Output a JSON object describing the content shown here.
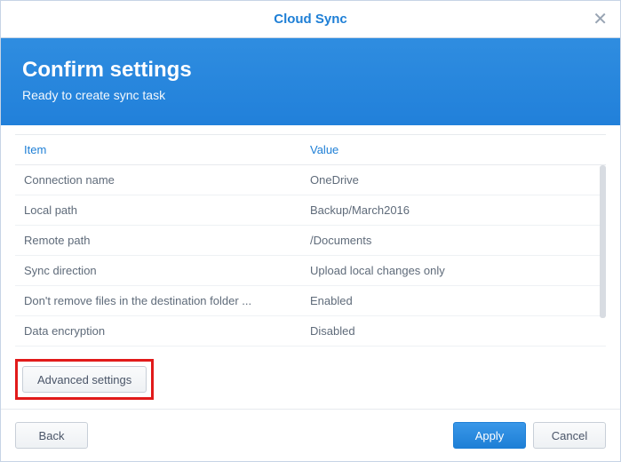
{
  "window": {
    "title": "Cloud Sync"
  },
  "banner": {
    "heading": "Confirm settings",
    "sub": "Ready to create sync task"
  },
  "table": {
    "headers": {
      "item": "Item",
      "value": "Value"
    },
    "rows": [
      {
        "item": "Connection name",
        "value": "OneDrive"
      },
      {
        "item": "Local path",
        "value": "Backup/March2016"
      },
      {
        "item": "Remote path",
        "value": "/Documents"
      },
      {
        "item": "Sync direction",
        "value": "Upload local changes only"
      },
      {
        "item": "Don't remove files in the destination folder ...",
        "value": "Enabled"
      },
      {
        "item": "Data encryption",
        "value": "Disabled"
      }
    ]
  },
  "buttons": {
    "advanced": "Advanced settings",
    "back": "Back",
    "apply": "Apply",
    "cancel": "Cancel"
  }
}
